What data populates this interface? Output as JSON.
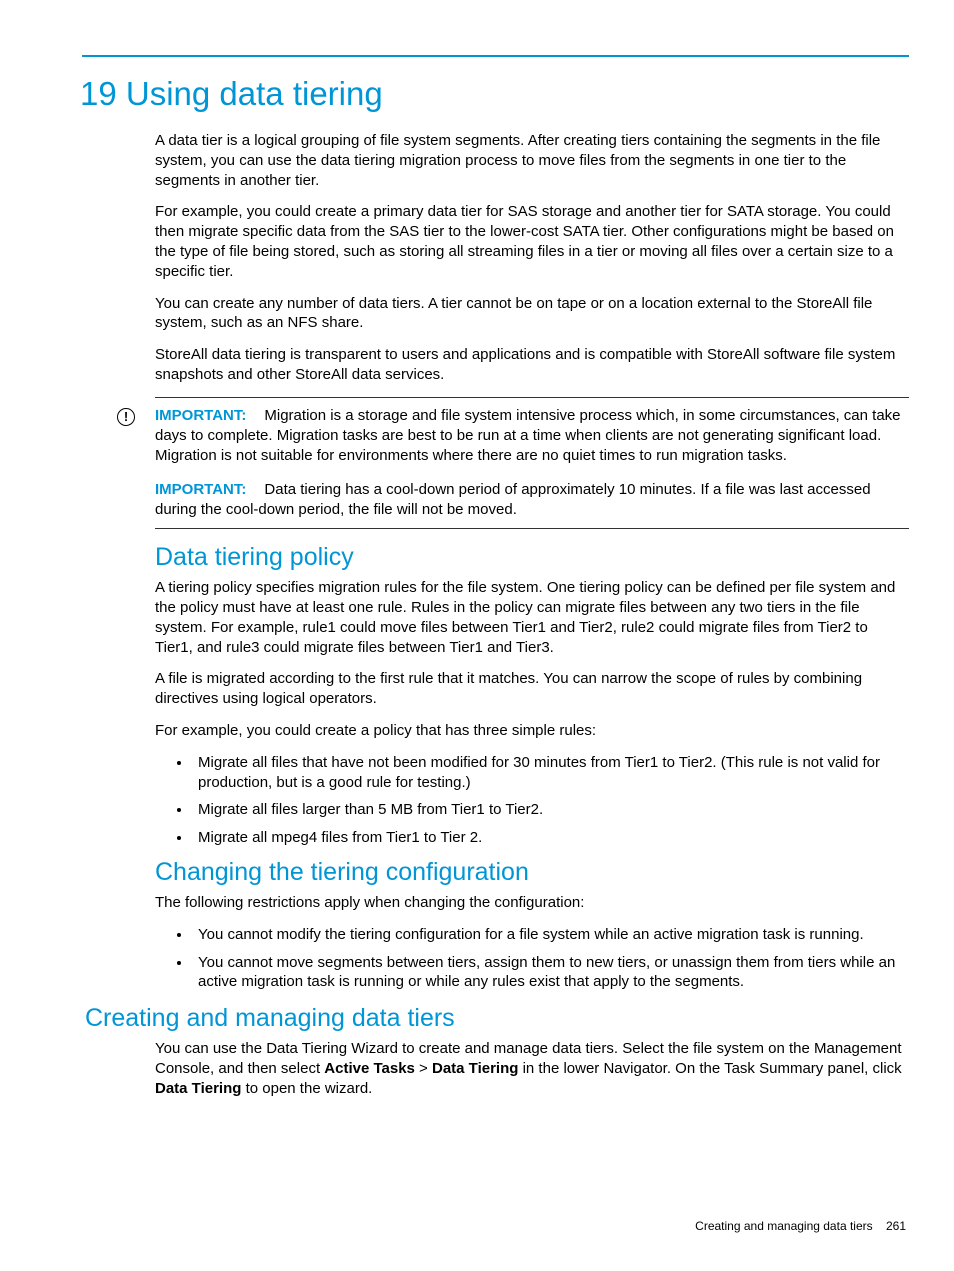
{
  "chapter": {
    "number": "19",
    "title": "Using data tiering"
  },
  "intro": {
    "p1": "A data tier is a logical grouping of file system segments. After creating tiers containing the segments in the file system, you can use the data tiering migration process to move files from the segments in one tier to the segments in another tier.",
    "p2": "For example, you could create a primary data tier for SAS storage and another tier for SATA storage. You could then migrate specific data from the SAS tier to the lower-cost SATA tier. Other configurations might be based on the type of file being stored, such as storing all streaming files in a tier or moving all files over a certain size to a specific tier.",
    "p3": "You can create any number of data tiers. A tier cannot be on tape or on a location external to the StoreAll file system, such as an NFS share.",
    "p4": "StoreAll data tiering is transparent to users and applications and is compatible with StoreAll software file system snapshots and other StoreAll data services."
  },
  "important": {
    "label": "IMPORTANT:",
    "p1": "Migration is a storage and file system intensive process which, in some circumstances, can take days to complete. Migration tasks are best to be run at a time when clients are not generating significant load. Migration is not suitable for environments where there are no quiet times to run migration tasks.",
    "p2": "Data tiering has a cool-down period of approximately 10 minutes. If a file was last accessed during the cool-down period, the file will not be moved."
  },
  "policy": {
    "heading": "Data tiering policy",
    "p1": "A tiering policy specifies migration rules for the file system. One tiering policy can be defined per file system and the policy must have at least one rule. Rules in the policy can migrate files between any two tiers in the file system. For example, rule1 could move files between Tier1 and Tier2, rule2 could migrate files from Tier2 to Tier1, and rule3 could migrate files between Tier1 and Tier3.",
    "p2": "A file is migrated according to the first rule that it matches. You can narrow the scope of rules by combining directives using logical operators.",
    "p3": "For example, you could create a policy that has three simple rules:",
    "bullets": [
      "Migrate all files that have not been modified for 30 minutes from Tier1 to Tier2. (This rule is not valid for production, but is a good rule for testing.)",
      "Migrate all files larger than 5 MB from Tier1 to Tier2.",
      "Migrate all mpeg4 files from Tier1 to Tier 2."
    ]
  },
  "changing": {
    "heading": "Changing the tiering configuration",
    "intro": "The following restrictions apply when changing the configuration:",
    "bullets": [
      "You cannot modify the tiering configuration for a file system while an active migration task is running.",
      "You cannot move segments between tiers, assign them to new tiers, or unassign them from tiers while an active migration task is running or while any rules exist that apply to the segments."
    ]
  },
  "creating": {
    "heading": "Creating and managing data tiers",
    "p1_pre": "You can use the Data Tiering Wizard to create and manage data tiers. Select the file system on the Management Console, and then select ",
    "p1_b1": "Active Tasks",
    "p1_gt": " > ",
    "p1_b2": "Data Tiering",
    "p1_mid": " in the lower Navigator. On the Task Summary panel, click ",
    "p1_b3": "Data Tiering",
    "p1_post": " to open the wizard."
  },
  "footer": {
    "text": "Creating and managing data tiers",
    "page": "261"
  }
}
